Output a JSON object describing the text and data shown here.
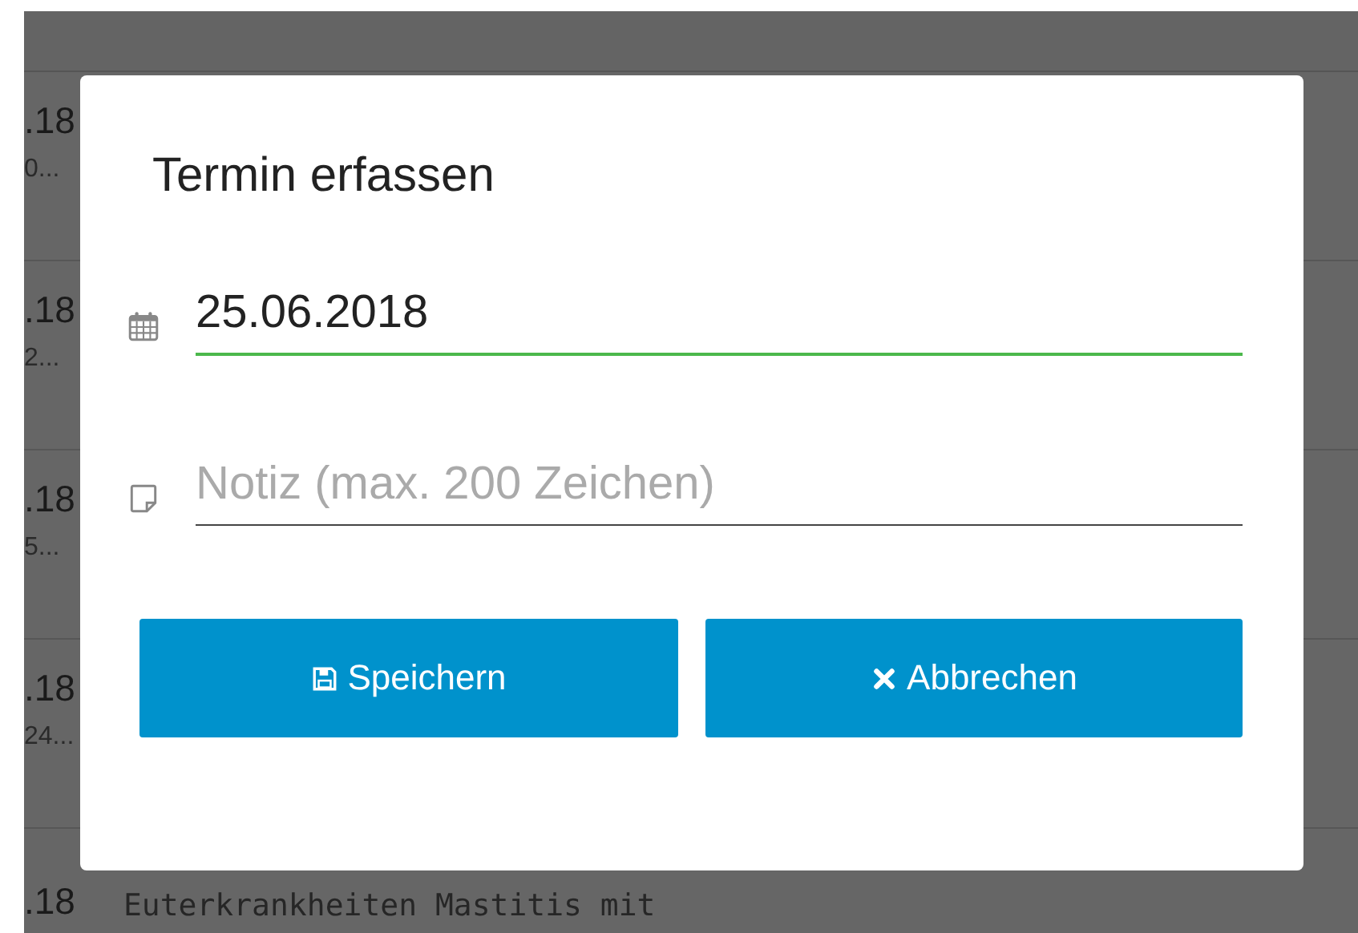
{
  "background_rows": [
    {
      "date": ".18",
      "note": "0..."
    },
    {
      "date": ".18",
      "note": "2..."
    },
    {
      "date": ".18",
      "note": "5..."
    },
    {
      "date": ".18",
      "note": "24..."
    },
    {
      "date": ".18",
      "note": "Euterkrankheiten Mastitis mit"
    }
  ],
  "dialog": {
    "title": "Termin erfassen",
    "fields": [
      {
        "kind": "date",
        "value": "25.06.2018",
        "valid": true
      },
      {
        "kind": "note",
        "placeholder": "Notiz (max. 200 Zeichen)",
        "valid": false
      }
    ],
    "buttons": [
      {
        "kind": "save",
        "label": "Speichern"
      },
      {
        "kind": "cancel",
        "label": "Abbrechen"
      }
    ]
  }
}
